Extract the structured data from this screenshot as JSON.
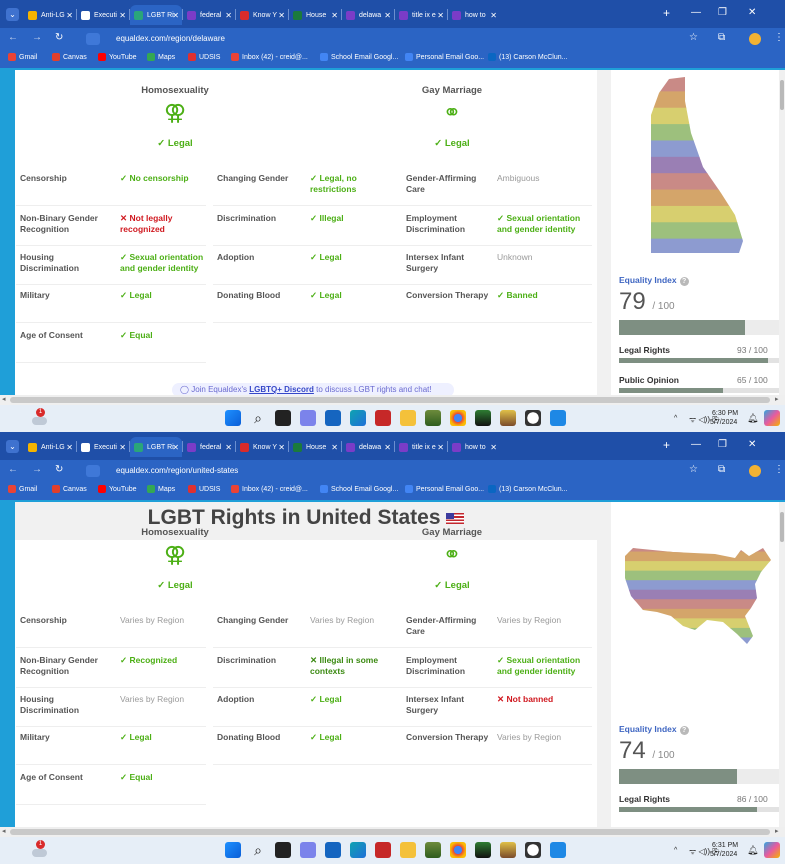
{
  "browser": {
    "tabs": [
      {
        "label": "Anti-LG",
        "color": "#f4b400"
      },
      {
        "label": "Executi",
        "color": "#ffffff"
      },
      {
        "label": "LGBT Ri",
        "color": "#2aa57a"
      },
      {
        "label": "federal",
        "color": "#7b3cc7"
      },
      {
        "label": "Know Y",
        "color": "#d92b2b"
      },
      {
        "label": "House",
        "color": "#1b7a3c"
      },
      {
        "label": "delawa",
        "color": "#7b3cc7"
      },
      {
        "label": "title ix e",
        "color": "#7b3cc7"
      },
      {
        "label": "how to",
        "color": "#7b3cc7"
      }
    ],
    "active_tab": 2,
    "new_tab": "+",
    "bookmarks": [
      {
        "label": "Gmail",
        "color": "#ea4335"
      },
      {
        "label": "Canvas",
        "color": "#e13f2b"
      },
      {
        "label": "YouTube",
        "color": "#ff0000"
      },
      {
        "label": "Maps",
        "color": "#34a853"
      },
      {
        "label": "UDSIS",
        "color": "#e03030"
      },
      {
        "label": "Inbox (42) - creid@...",
        "color": "#ea4335"
      },
      {
        "label": "School Email Googl...",
        "color": "#4285f4"
      },
      {
        "label": "Personal Email Goo...",
        "color": "#4285f4"
      },
      {
        "label": "(13) Carson McClun...",
        "color": "#0a66c2"
      }
    ]
  },
  "screens": [
    {
      "url": "equaldex.com/region/delaware",
      "page_title": "",
      "homosexuality": {
        "title": "Homosexuality",
        "status": "✓ Legal"
      },
      "gay_marriage": {
        "title": "Gay Marriage",
        "status": "✓ Legal"
      },
      "rows": [
        [
          {
            "label": "Censorship",
            "value": "✓ No censorship",
            "kind": "ok"
          },
          {
            "label": "Changing Gender",
            "value": "✓ Legal, no restrictions",
            "kind": "ok"
          },
          {
            "label": "Gender-Affirming Care",
            "value": "Ambiguous",
            "kind": "gray"
          }
        ],
        [
          {
            "label": "Non-Binary Gender Recognition",
            "value": "✕ Not legally recognized",
            "kind": "bad"
          },
          {
            "label": "Discrimination",
            "value": "✓ Illegal",
            "kind": "ok"
          },
          {
            "label": "Employment Discrimination",
            "value": "✓ Sexual orientation and gender identity",
            "kind": "ok"
          }
        ],
        [
          {
            "label": "Housing Discrimination",
            "value": "✓ Sexual orientation and gender identity",
            "kind": "ok"
          },
          {
            "label": "Adoption",
            "value": "✓ Legal",
            "kind": "ok"
          },
          {
            "label": "Intersex Infant Surgery",
            "value": "Unknown",
            "kind": "gray"
          }
        ],
        [
          {
            "label": "Military",
            "value": "✓ Legal",
            "kind": "ok"
          },
          {
            "label": "Donating Blood",
            "value": "✓ Legal",
            "kind": "ok"
          },
          {
            "label": "Conversion Therapy",
            "value": "✓ Banned",
            "kind": "ok"
          }
        ],
        [
          {
            "label": "Age of Consent",
            "value": "✓ Equal",
            "kind": "ok"
          }
        ]
      ],
      "equality": {
        "label": "Equality Index",
        "score": "79",
        "max": "/ 100",
        "score_value": 79,
        "sub": [
          {
            "label": "Legal Rights",
            "value": "93 / 100",
            "fraction": 0.93
          },
          {
            "label": "Public Opinion",
            "value": "65 / 100",
            "fraction": 0.65
          }
        ]
      },
      "discord": {
        "prefix": "Join Equaldex's",
        "link": "LGBTQ+ Discord",
        "suffix": "to discuss LGBT rights and chat!"
      },
      "taskbar": {
        "time": "6:30 PM",
        "date": "5/7/2024",
        "weather_badge": "1"
      }
    },
    {
      "url": "equaldex.com/region/united-states",
      "page_title": "LGBT Rights in United States",
      "homosexuality": {
        "title": "Homosexuality",
        "status": "✓ Legal"
      },
      "gay_marriage": {
        "title": "Gay Marriage",
        "status": "✓ Legal"
      },
      "rows": [
        [
          {
            "label": "Censorship",
            "value": "Varies by Region",
            "kind": "gray"
          },
          {
            "label": "Changing Gender",
            "value": "Varies by Region",
            "kind": "gray"
          },
          {
            "label": "Gender-Affirming Care",
            "value": "Varies by Region",
            "kind": "gray"
          }
        ],
        [
          {
            "label": "Non-Binary Gender Recognition",
            "value": "✓ Recognized",
            "kind": "ok"
          },
          {
            "label": "Discrimination",
            "value": "✕ Illegal in some contexts",
            "kind": "okdark"
          },
          {
            "label": "Employment Discrimination",
            "value": "✓ Sexual orientation and gender identity",
            "kind": "ok"
          }
        ],
        [
          {
            "label": "Housing Discrimination",
            "value": "Varies by Region",
            "kind": "gray"
          },
          {
            "label": "Adoption",
            "value": "✓ Legal",
            "kind": "ok"
          },
          {
            "label": "Intersex Infant Surgery",
            "value": "✕ Not banned",
            "kind": "bad"
          }
        ],
        [
          {
            "label": "Military",
            "value": "✓ Legal",
            "kind": "ok"
          },
          {
            "label": "Donating Blood",
            "value": "✓ Legal",
            "kind": "ok"
          },
          {
            "label": "Conversion Therapy",
            "value": "Varies by Region",
            "kind": "gray"
          }
        ],
        [
          {
            "label": "Age of Consent",
            "value": "✓ Equal",
            "kind": "ok"
          }
        ]
      ],
      "equality": {
        "label": "Equality Index",
        "score": "74",
        "max": "/ 100",
        "score_value": 74,
        "sub": [
          {
            "label": "Legal Rights",
            "value": "86 / 100",
            "fraction": 0.86
          }
        ]
      },
      "discord": null,
      "taskbar": {
        "time": "6:31 PM",
        "date": "5/7/2024",
        "weather_badge": "1"
      }
    }
  ],
  "colors": {
    "legal_green": "#4caf15",
    "bad_red": "#d0181f",
    "accent_blue": "#3f66c2",
    "desktop_blue": "#1f9fd8"
  }
}
